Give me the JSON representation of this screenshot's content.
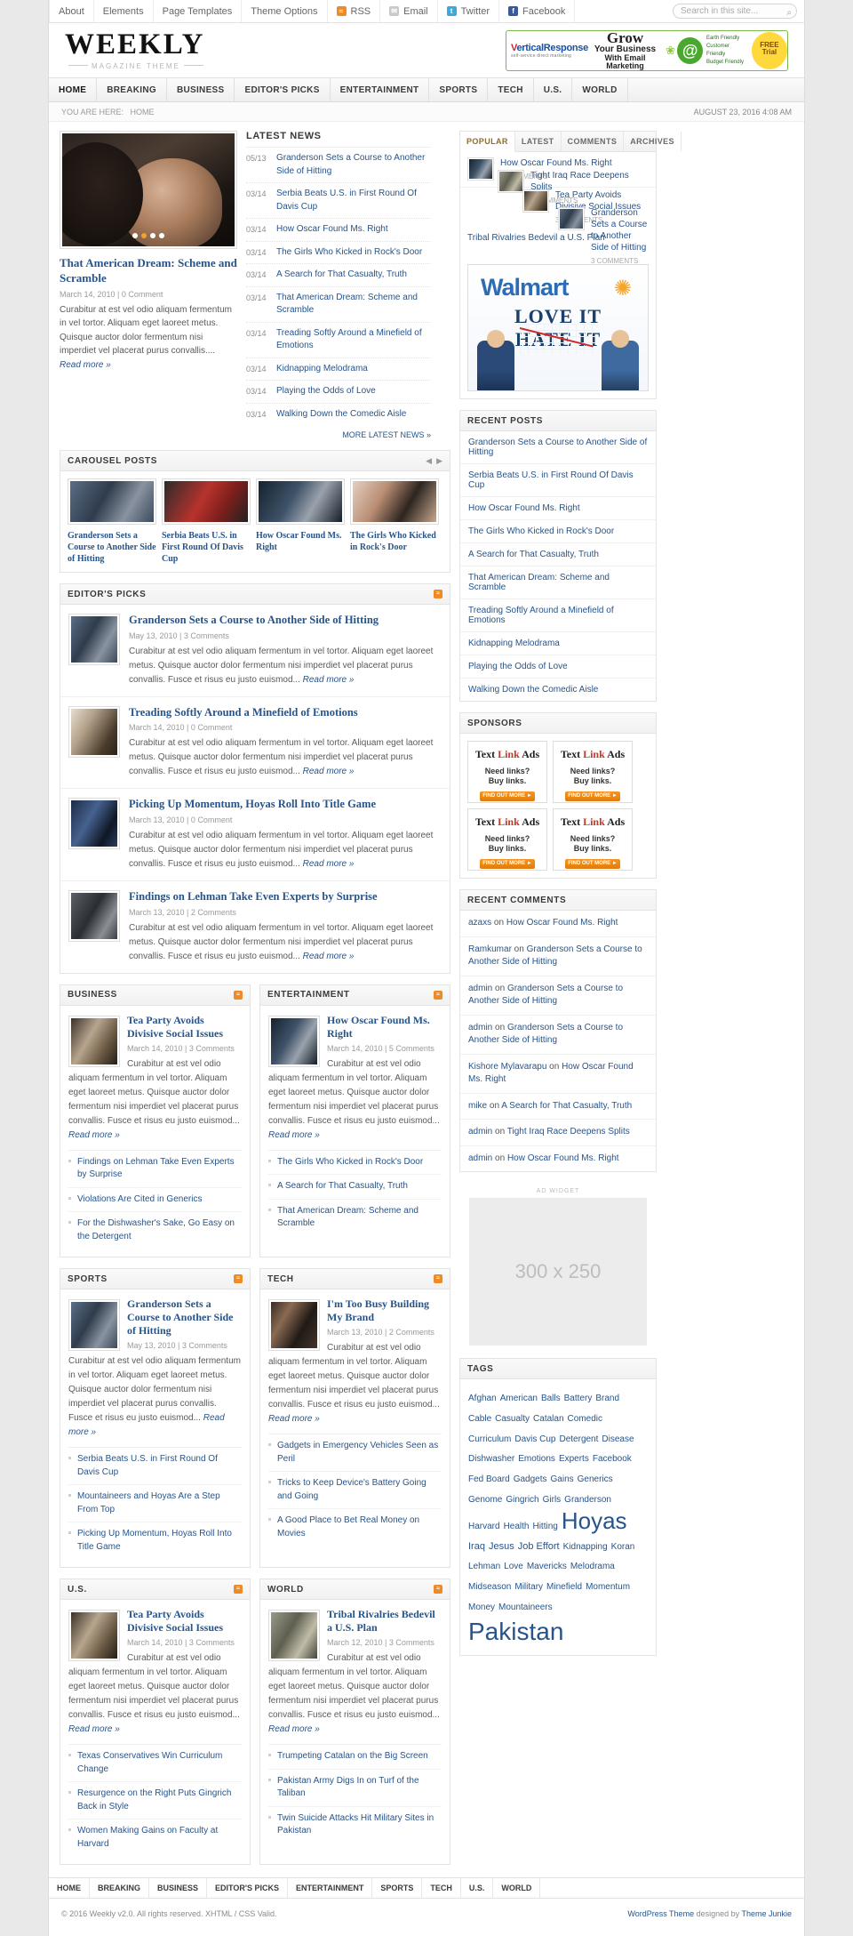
{
  "topbar": {
    "links": [
      "About",
      "Elements",
      "Page Templates",
      "Theme Options"
    ],
    "social": [
      {
        "label": "RSS",
        "icon": "rss-icon"
      },
      {
        "label": "Email",
        "icon": "email-icon"
      },
      {
        "label": "Twitter",
        "icon": "twitter-icon"
      },
      {
        "label": "Facebook",
        "icon": "facebook-icon"
      }
    ],
    "search_placeholder": "Search in this site...",
    "search_value": ""
  },
  "header": {
    "logo_name": "WEEKLY",
    "logo_tagline": "MAGAZINE THEME",
    "banner": {
      "brand_v": "V",
      "brand_rest": "erticalResponse",
      "brand_sub": "self-service direct marketing",
      "line1": "Grow",
      "line2": "Your Business",
      "line3": "With Email Marketing",
      "at": "@",
      "eco": "Earth Friendly\nCustomer Friendly\nBudget Friendly",
      "free": "FREE Trial"
    }
  },
  "mainnav": [
    "HOME",
    "BREAKING",
    "BUSINESS",
    "EDITOR'S PICKS",
    "ENTERTAINMENT",
    "SPORTS",
    "TECH",
    "U.S.",
    "WORLD"
  ],
  "breadcrumb": {
    "label": "YOU ARE HERE:",
    "current": "HOME",
    "date": "AUGUST 23, 2016 4:08 AM"
  },
  "feature": {
    "title": "That American Dream: Scheme and Scramble",
    "meta": "March 14, 2010  |  0 Comment",
    "excerpt": "Curabitur at est vel odio aliquam fermentum in vel tortor. Aliquam eget laoreet metus. Quisque auctor dolor fermentum nisi imperdiet vel placerat purus convallis.... ",
    "read_more": "Read more »",
    "dots_total": 5,
    "dots_active": 1
  },
  "latest_news": {
    "title": "LATEST NEWS",
    "more": "MORE LATEST NEWS »",
    "items": [
      {
        "date": "05/13",
        "title": "Granderson Sets a Course to Another Side of Hitting"
      },
      {
        "date": "03/14",
        "title": "Serbia Beats U.S. in First Round Of Davis Cup"
      },
      {
        "date": "03/14",
        "title": "How Oscar Found Ms. Right"
      },
      {
        "date": "03/14",
        "title": "The Girls Who Kicked in Rock's Door"
      },
      {
        "date": "03/14",
        "title": "A Search for That Casualty, Truth"
      },
      {
        "date": "03/14",
        "title": "That American Dream: Scheme and Scramble"
      },
      {
        "date": "03/14",
        "title": "Treading Softly Around a Minefield of Emotions"
      },
      {
        "date": "03/14",
        "title": "Kidnapping Melodrama"
      },
      {
        "date": "03/14",
        "title": "Playing the Odds of Love"
      },
      {
        "date": "03/14",
        "title": "Walking Down the Comedic Aisle"
      }
    ]
  },
  "carousel": {
    "title": "CAROUSEL POSTS",
    "prev": "◀",
    "next": "▶",
    "items": [
      {
        "title": "Granderson Sets a Course to Another Side of Hitting",
        "thumb": "t-baseball"
      },
      {
        "title": "Serbia Beats U.S. in First Round Of Davis Cup",
        "thumb": "t-tennis"
      },
      {
        "title": "How Oscar Found Ms. Right",
        "thumb": "t-oscar"
      },
      {
        "title": "The Girls Who Kicked in Rock's Door",
        "thumb": "t-girls"
      }
    ]
  },
  "editors_picks": {
    "title": "EDITOR'S PICKS",
    "items": [
      {
        "title": "Granderson Sets a Course to Another Side of Hitting",
        "meta": "May 13, 2010  |  3 Comments",
        "excerpt": "Curabitur at est vel odio aliquam fermentum in vel tortor. Aliquam eget laoreet metus. Quisque auctor dolor fermentum nisi imperdiet vel placerat purus convallis. Fusce et risus eu justo euismod... ",
        "read_more": "Read more »",
        "thumb": "t-baseball"
      },
      {
        "title": "Treading Softly Around a Minefield of Emotions",
        "meta": "March 14, 2010  |  0 Comment",
        "excerpt": "Curabitur at est vel odio aliquam fermentum in vel tortor. Aliquam eget laoreet metus. Quisque auctor dolor fermentum nisi imperdiet vel placerat purus convallis. Fusce et risus eu justo euismod... ",
        "read_more": "Read more »",
        "thumb": "t-cafe"
      },
      {
        "title": "Picking Up Momentum, Hoyas Roll Into Title Game",
        "meta": "March 13, 2010  |  0 Comment",
        "excerpt": "Curabitur at est vel odio aliquam fermentum in vel tortor. Aliquam eget laoreet metus. Quisque auctor dolor fermentum nisi imperdiet vel placerat purus convallis. Fusce et risus eu justo euismod... ",
        "read_more": "Read more »",
        "thumb": "t-hoyas"
      },
      {
        "title": "Findings on Lehman Take Even Experts by Surprise",
        "meta": "March 13, 2010  |  2 Comments",
        "excerpt": "Curabitur at est vel odio aliquam fermentum in vel tortor. Aliquam eget laoreet metus. Quisque auctor dolor fermentum nisi imperdiet vel placerat purus convallis. Fusce et risus eu justo euismod... ",
        "read_more": "Read more »",
        "thumb": "t-lehman"
      }
    ]
  },
  "categories": [
    {
      "title": "BUSINESS",
      "lead": {
        "title": "Tea Party Avoids Divisive Social Issues",
        "meta": "March 14, 2010  |  3 Comments",
        "excerpt": "Curabitur at est vel odio aliquam fermentum in vel tortor. Aliquam eget laoreet metus. Quisque auctor dolor fermentum nisi imperdiet vel placerat purus convallis. Fusce et risus eu justo euismod... ",
        "read_more": "Read more »",
        "thumb": "t-teaparty"
      },
      "links": [
        "Findings on Lehman Take Even Experts by Surprise",
        "Violations Are Cited in Generics",
        "For the Dishwasher's Sake, Go Easy on the Detergent"
      ]
    },
    {
      "title": "ENTERTAINMENT",
      "lead": {
        "title": "How Oscar Found Ms. Right",
        "meta": "March 14, 2010  |  5 Comments",
        "excerpt": "Curabitur at est vel odio aliquam fermentum in vel tortor. Aliquam eget laoreet metus. Quisque auctor dolor fermentum nisi imperdiet vel placerat purus convallis. Fusce et risus eu justo euismod... ",
        "read_more": "Read more »",
        "thumb": "t-oscar"
      },
      "links": [
        "The Girls Who Kicked in Rock's Door",
        "A Search for That Casualty, Truth",
        "That American Dream: Scheme and Scramble"
      ]
    },
    {
      "title": "SPORTS",
      "lead": {
        "title": "Granderson Sets a Course to Another Side of Hitting",
        "meta": "May 13, 2010  |  3 Comments",
        "excerpt": "Curabitur at est vel odio aliquam fermentum in vel tortor. Aliquam eget laoreet metus. Quisque auctor dolor fermentum nisi imperdiet vel placerat purus convallis. Fusce et risus eu justo euismod... ",
        "read_more": "Read more »",
        "thumb": "t-baseball"
      },
      "links": [
        "Serbia Beats U.S. in First Round Of Davis Cup",
        "Mountaineers and Hoyas Are a Step From Top",
        "Picking Up Momentum, Hoyas Roll Into Title Game"
      ]
    },
    {
      "title": "TECH",
      "lead": {
        "title": "I'm Too Busy Building My Brand",
        "meta": "March 13, 2010  |  2 Comments",
        "excerpt": "Curabitur at est vel odio aliquam fermentum in vel tortor. Aliquam eget laoreet metus. Quisque auctor dolor fermentum nisi imperdiet vel placerat purus convallis. Fusce et risus eu justo euismod... ",
        "read_more": "Read more »",
        "thumb": "t-laptop"
      },
      "links": [
        "Gadgets in Emergency Vehicles Seen as Peril",
        "Tricks to Keep Device's Battery Going and Going",
        "A Good Place to Bet Real Money on Movies"
      ]
    },
    {
      "title": "U.S.",
      "lead": {
        "title": "Tea Party Avoids Divisive Social Issues",
        "meta": "March 14, 2010  |  3 Comments",
        "excerpt": "Curabitur at est vel odio aliquam fermentum in vel tortor. Aliquam eget laoreet metus. Quisque auctor dolor fermentum nisi imperdiet vel placerat purus convallis. Fusce et risus eu justo euismod... ",
        "read_more": "Read more »",
        "thumb": "t-teaparty"
      },
      "links": [
        "Texas Conservatives Win Curriculum Change",
        "Resurgence on the Right Puts Gingrich Back in Style",
        "Women Making Gains on Faculty at Harvard"
      ]
    },
    {
      "title": "WORLD",
      "lead": {
        "title": "Tribal Rivalries Bedevil a U.S. Plan",
        "meta": "March 12, 2010  |  3 Comments",
        "excerpt": "Curabitur at est vel odio aliquam fermentum in vel tortor. Aliquam eget laoreet metus. Quisque auctor dolor fermentum nisi imperdiet vel placerat purus convallis. Fusce et risus eu justo euismod... ",
        "read_more": "Read more »",
        "thumb": "t-world"
      },
      "links": [
        "Trumpeting Catalan on the Big Screen",
        "Pakistan Army Digs In on Turf of the Taliban",
        "Twin Suicide Attacks Hit Military Sites in Pakistan"
      ]
    }
  ],
  "sidebar": {
    "tabs": [
      "POPULAR",
      "LATEST",
      "COMMENTS",
      "ARCHIVES"
    ],
    "active_tab": "POPULAR",
    "popular": [
      {
        "title": "How Oscar Found Ms. Right",
        "comments": "5 COMMENTS",
        "thumb": "t-oscar"
      },
      {
        "title": "Tight Iraq Race Deepens Splits",
        "comments": "4 COMMENTS",
        "thumb": "t-world"
      },
      {
        "title": "Tea Party Avoids Divisive Social Issues",
        "comments": "3 COMMENTS",
        "thumb": "t-teaparty"
      },
      {
        "title": "Granderson Sets a Course to Another Side of Hitting",
        "comments": "3 COMMENTS",
        "thumb": "t-baseball"
      },
      {
        "title": "Tribal Rivalries Bedevil a U.S. Plan",
        "comments": "3 COMMENTS",
        "thumb": "t-world"
      }
    ],
    "ad_walmart": {
      "brand": "Walmart",
      "line1": "LOVE IT",
      "line2": "HATE IT",
      "spark": "✺"
    },
    "recent_posts": {
      "title": "RECENT POSTS",
      "items": [
        "Granderson Sets a Course to Another Side of Hitting",
        "Serbia Beats U.S. in First Round Of Davis Cup",
        "How Oscar Found Ms. Right",
        "The Girls Who Kicked in Rock's Door",
        "A Search for That Casualty, Truth",
        "That American Dream: Scheme and Scramble",
        "Treading Softly Around a Minefield of Emotions",
        "Kidnapping Melodrama",
        "Playing the Odds of Love",
        "Walking Down the Comedic Aisle"
      ]
    },
    "sponsors": {
      "title": "SPONSORS",
      "items": [
        {
          "brand_a": "Text ",
          "brand_b": "Link",
          "brand_c": " Ads",
          "l1": "Need links?",
          "l2": "Buy links.",
          "btn": "FIND OUT MORE ►"
        },
        {
          "brand_a": "Text ",
          "brand_b": "Link",
          "brand_c": " Ads",
          "l1": "Need links?",
          "l2": "Buy links.",
          "btn": "FIND OUT MORE ►"
        },
        {
          "brand_a": "Text ",
          "brand_b": "Link",
          "brand_c": " Ads",
          "l1": "Need links?",
          "l2": "Buy links.",
          "btn": "FIND OUT MORE ►"
        },
        {
          "brand_a": "Text ",
          "brand_b": "Link",
          "brand_c": " Ads",
          "l1": "Need links?",
          "l2": "Buy links.",
          "btn": "FIND OUT MORE ►"
        }
      ]
    },
    "recent_comments": {
      "title": "RECENT COMMENTS",
      "items": [
        {
          "author": "azaxs",
          "on": " on ",
          "post": "How Oscar Found Ms. Right"
        },
        {
          "author": "Ramkumar",
          "on": " on ",
          "post": "Granderson Sets a Course to Another Side of Hitting"
        },
        {
          "author": "admin",
          "on": " on ",
          "post": "Granderson Sets a Course to Another Side of Hitting"
        },
        {
          "author": "admin",
          "on": " on ",
          "post": "Granderson Sets a Course to Another Side of Hitting"
        },
        {
          "author": "Kishore Mylavarapu",
          "on": " on ",
          "post": "How Oscar Found Ms. Right"
        },
        {
          "author": "mike",
          "on": " on ",
          "post": "A Search for That Casualty, Truth"
        },
        {
          "author": "admin",
          "on": " on ",
          "post": "Tight Iraq Race Deepens Splits"
        },
        {
          "author": "admin",
          "on": " on ",
          "post": "How Oscar Found Ms. Right"
        }
      ]
    },
    "ad_widget": {
      "label": "AD WIDGET",
      "size": "300 x 250"
    },
    "tags": {
      "title": "TAGS",
      "items": [
        {
          "label": "Afghan",
          "size": 10
        },
        {
          "label": "American",
          "size": 10
        },
        {
          "label": "Balls",
          "size": 10
        },
        {
          "label": "Battery",
          "size": 10
        },
        {
          "label": "Brand",
          "size": 10
        },
        {
          "label": "Cable",
          "size": 10
        },
        {
          "label": "Casualty",
          "size": 10
        },
        {
          "label": "Catalan",
          "size": 10
        },
        {
          "label": "Comedic",
          "size": 10
        },
        {
          "label": "Curriculum",
          "size": 10
        },
        {
          "label": "Davis Cup",
          "size": 10
        },
        {
          "label": "Detergent",
          "size": 10
        },
        {
          "label": "Disease",
          "size": 10
        },
        {
          "label": "Dishwasher",
          "size": 10
        },
        {
          "label": "Emotions",
          "size": 10
        },
        {
          "label": "Experts",
          "size": 10
        },
        {
          "label": "Facebook",
          "size": 10
        },
        {
          "label": "Fed Board",
          "size": 10
        },
        {
          "label": "Gadgets",
          "size": 10
        },
        {
          "label": "Gains",
          "size": 10
        },
        {
          "label": "Generics",
          "size": 10
        },
        {
          "label": "Genome",
          "size": 10
        },
        {
          "label": "Gingrich",
          "size": 10
        },
        {
          "label": "Girls",
          "size": 10
        },
        {
          "label": "Granderson",
          "size": 10
        },
        {
          "label": "Harvard",
          "size": 10
        },
        {
          "label": "Health",
          "size": 10
        },
        {
          "label": "Hitting",
          "size": 10
        },
        {
          "label": "Hoyas",
          "size": 26
        },
        {
          "label": "Iraq",
          "size": 11
        },
        {
          "label": "Jesus",
          "size": 11
        },
        {
          "label": "Job Effort",
          "size": 11
        },
        {
          "label": "Kidnapping",
          "size": 10
        },
        {
          "label": "Koran",
          "size": 10
        },
        {
          "label": "Lehman",
          "size": 10
        },
        {
          "label": "Love",
          "size": 10
        },
        {
          "label": "Mavericks",
          "size": 10
        },
        {
          "label": "Melodrama",
          "size": 10
        },
        {
          "label": "Midseason",
          "size": 10
        },
        {
          "label": "Military",
          "size": 10
        },
        {
          "label": "Minefield",
          "size": 10
        },
        {
          "label": "Momentum",
          "size": 10
        },
        {
          "label": "Money",
          "size": 10
        },
        {
          "label": "Mountaineers",
          "size": 10
        },
        {
          "label": "Pakistan",
          "size": 28
        }
      ]
    }
  },
  "footer": {
    "nav": [
      "HOME",
      "BREAKING",
      "BUSINESS",
      "EDITOR'S PICKS",
      "ENTERTAINMENT",
      "SPORTS",
      "TECH",
      "U.S.",
      "WORLD"
    ],
    "copyright": "© 2016 Weekly v2.0. All rights reserved. XHTML / CSS Valid.",
    "credit_prefix": "WordPress Theme",
    "credit_mid": " designed by ",
    "credit_link": "Theme Junkie"
  }
}
